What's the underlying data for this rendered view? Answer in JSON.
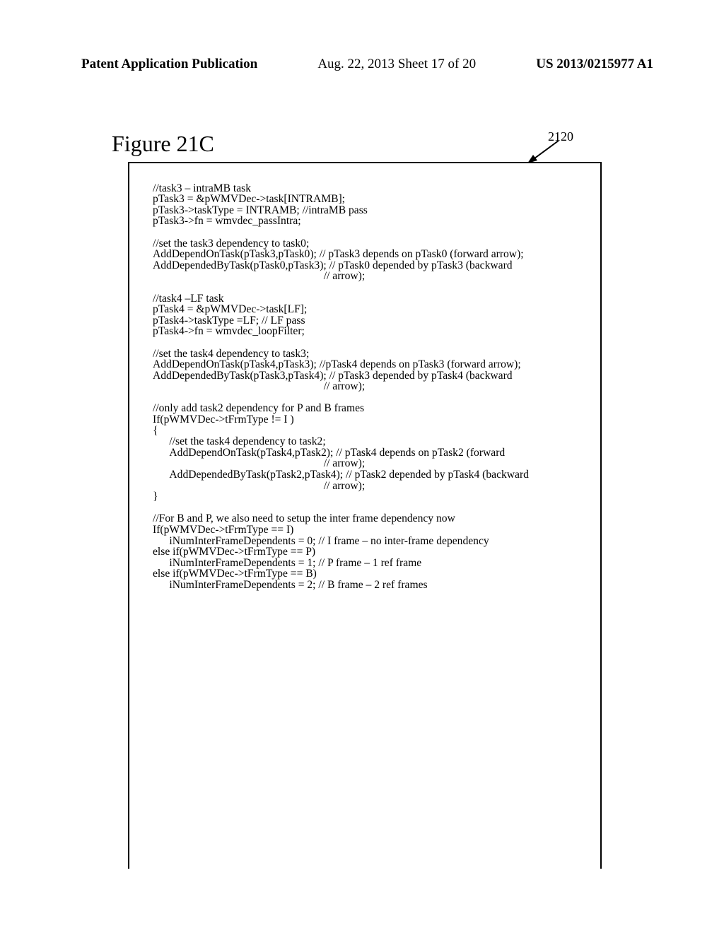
{
  "header": {
    "left": "Patent Application Publication",
    "center": "Aug. 22, 2013  Sheet 17 of 20",
    "right": "US 2013/0215977 A1"
  },
  "figure": {
    "title": "Figure 21C",
    "ref": "2120"
  },
  "code": "//task3 – intraMB task\npTask3 = &pWMVDec->task[INTRAMB];\npTask3->taskType = INTRAMB; //intraMB pass\npTask3->fn = wmvdec_passIntra;\n\n//set the task3 dependency to task0;\nAddDependOnTask(pTask3,pTask0); // pTask3 depends on pTask0 (forward arrow);\nAddDependedByTask(pTask0,pTask3); // pTask0 depended by pTask3 (backward\n                                                              // arrow);\n\n//task4 –LF task\npTask4 = &pWMVDec->task[LF];\npTask4->taskType =LF; // LF pass\npTask4->fn = wmvdec_loopFilter;\n\n//set the task4 dependency to task3;\nAddDependOnTask(pTask4,pTask3); //pTask4 depends on pTask3 (forward arrow);\nAddDependedByTask(pTask3,pTask4); // pTask3 depended by pTask4 (backward\n                                                              // arrow);\n\n//only add task2 dependency for P and B frames\nIf(pWMVDec->tFrmType != I )\n{\n      //set the task4 dependency to task2;\n      AddDependOnTask(pTask4,pTask2); // pTask4 depends on pTask2 (forward\n                                                              // arrow);\n      AddDependedByTask(pTask2,pTask4); // pTask2 depended by pTask4 (backward\n                                                              // arrow);\n}\n\n//For B and P, we also need to setup the inter frame dependency now\nIf(pWMVDec->tFrmType == I)\n      iNumInterFrameDependents = 0; // I frame – no inter-frame dependency\nelse if(pWMVDec->tFrmType == P)\n      iNumInterFrameDependents = 1; // P frame – 1 ref frame\nelse if(pWMVDec->tFrmType == B)\n      iNumInterFrameDependents = 2; // B frame – 2 ref frames"
}
